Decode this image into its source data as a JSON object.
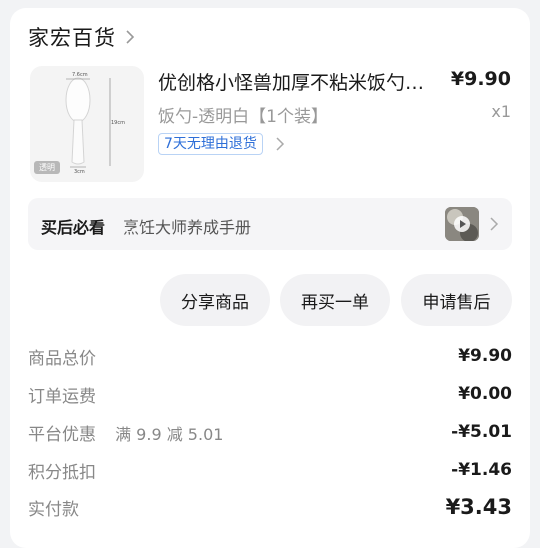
{
  "shop": {
    "name": "家宏百货"
  },
  "product": {
    "title": "优创格小怪兽加厚不粘米饭勺…",
    "price": "¥9.90",
    "variant": "饭勺-透明白【1个装】",
    "quantity": "x1",
    "return_policy": "7天无理由退货",
    "image_labels": {
      "width": "7.6cm",
      "height": "19cm",
      "base": "3cm",
      "badge": "透明"
    }
  },
  "after_sales_guide": {
    "label": "买后必看",
    "text": "烹饪大师养成手册"
  },
  "actions": {
    "share": "分享商品",
    "rebuy": "再买一单",
    "after_sale": "申请售后"
  },
  "summary": {
    "goods_total": {
      "label": "商品总价",
      "value": "¥9.90"
    },
    "shipping": {
      "label": "订单运费",
      "value": "¥0.00"
    },
    "platform_discount": {
      "label": "平台优惠",
      "detail": "满 9.9 减 5.01",
      "value": "-¥5.01"
    },
    "points": {
      "label": "积分抵扣",
      "value": "-¥1.46"
    },
    "paid": {
      "label": "实付款",
      "value": "¥3.43"
    }
  }
}
